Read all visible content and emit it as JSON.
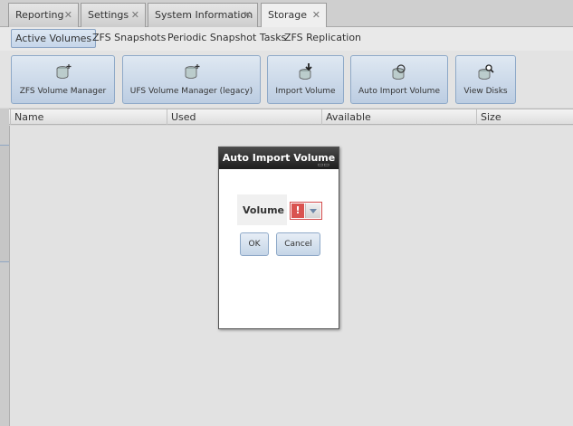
{
  "tabs": [
    {
      "label": "Reporting"
    },
    {
      "label": "Settings"
    },
    {
      "label": "System Information"
    },
    {
      "label": "Storage"
    }
  ],
  "subtabs": [
    {
      "label": "Active Volumes"
    },
    {
      "label": "ZFS Snapshots"
    },
    {
      "label": "Periodic Snapshot Tasks"
    },
    {
      "label": "ZFS Replication"
    }
  ],
  "toolbar": {
    "buttons": [
      {
        "label": "ZFS Volume Manager",
        "icon": "disk-add-icon"
      },
      {
        "label": "UFS Volume Manager (legacy)",
        "icon": "disk-add-icon"
      },
      {
        "label": "Import Volume",
        "icon": "disk-import-icon"
      },
      {
        "label": "Auto Import Volume",
        "icon": "disk-auto-import-icon"
      },
      {
        "label": "View Disks",
        "icon": "disk-search-icon"
      }
    ]
  },
  "grid": {
    "columns": [
      "Name",
      "Used",
      "Available",
      "Size"
    ]
  },
  "dialog": {
    "title": "Auto Import Volume",
    "volume_label": "Volume",
    "error_mark": "!",
    "ok_label": "OK",
    "cancel_label": "Cancel"
  },
  "colors": {
    "accent": "#8ea9c8",
    "error": "#d9534f",
    "dialog_title_bg": "#1e1e1e"
  }
}
